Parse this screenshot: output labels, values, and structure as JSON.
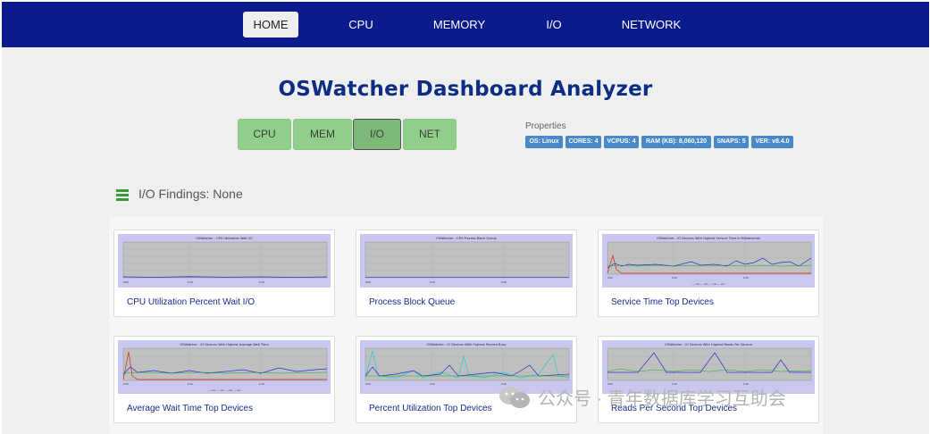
{
  "nav": {
    "items": [
      {
        "label": "HOME",
        "active": true
      },
      {
        "label": "CPU",
        "active": false
      },
      {
        "label": "MEMORY",
        "active": false
      },
      {
        "label": "I/O",
        "active": false
      },
      {
        "label": "NETWORK",
        "active": false
      }
    ]
  },
  "page_title": "OSWatcher Dashboard Analyzer",
  "quick_buttons": [
    {
      "label": "CPU",
      "active": false
    },
    {
      "label": "MEM",
      "active": false
    },
    {
      "label": "I/O",
      "active": true
    },
    {
      "label": "NET",
      "active": false
    }
  ],
  "properties": {
    "label": "Properties",
    "badges": [
      "OS: Linux",
      "CORES: 4",
      "VCPUS: 4",
      "RAM (KB): 8,060,120",
      "SNAPS: 5",
      "VER: v8.4.0"
    ]
  },
  "findings": {
    "icon": "list-icon",
    "text": "I/O Findings: None"
  },
  "charts": [
    {
      "title": "OSWatcher - CPU Utilization Wait I/O",
      "label": "CPU Utilization Percent Wait I/O"
    },
    {
      "title": "OSWatcher - CPU Process Block Queue",
      "label": "Process Block Queue"
    },
    {
      "title": "OSWatcher - IO Devices With Highest Service Time in Milliseconds",
      "label": "Service Time Top Devices"
    },
    {
      "title": "OSWatcher - IO Devices With Highest Average Wait Time",
      "label": "Average Wait Time Top Devices"
    },
    {
      "title": "OSWatcher - IO Devices With Highest Percent Busy",
      "label": "Percent Utilization Top Devices"
    },
    {
      "title": "OSWatcher - IO Devices With Highest Reads Per Second",
      "label": "Reads Per Second Top Devices"
    }
  ],
  "colors": {
    "navbar": "#0b1a8c",
    "title": "#0c2d83",
    "button_green": "#8fcf8a",
    "badge_blue": "#4a89c9",
    "chart_bg": "#c9c9ef",
    "plot_bg": "#c0c0c0"
  },
  "watermark": {
    "icon": "wechat-icon",
    "text": "公众号 · 青年数据库学习互助会"
  }
}
